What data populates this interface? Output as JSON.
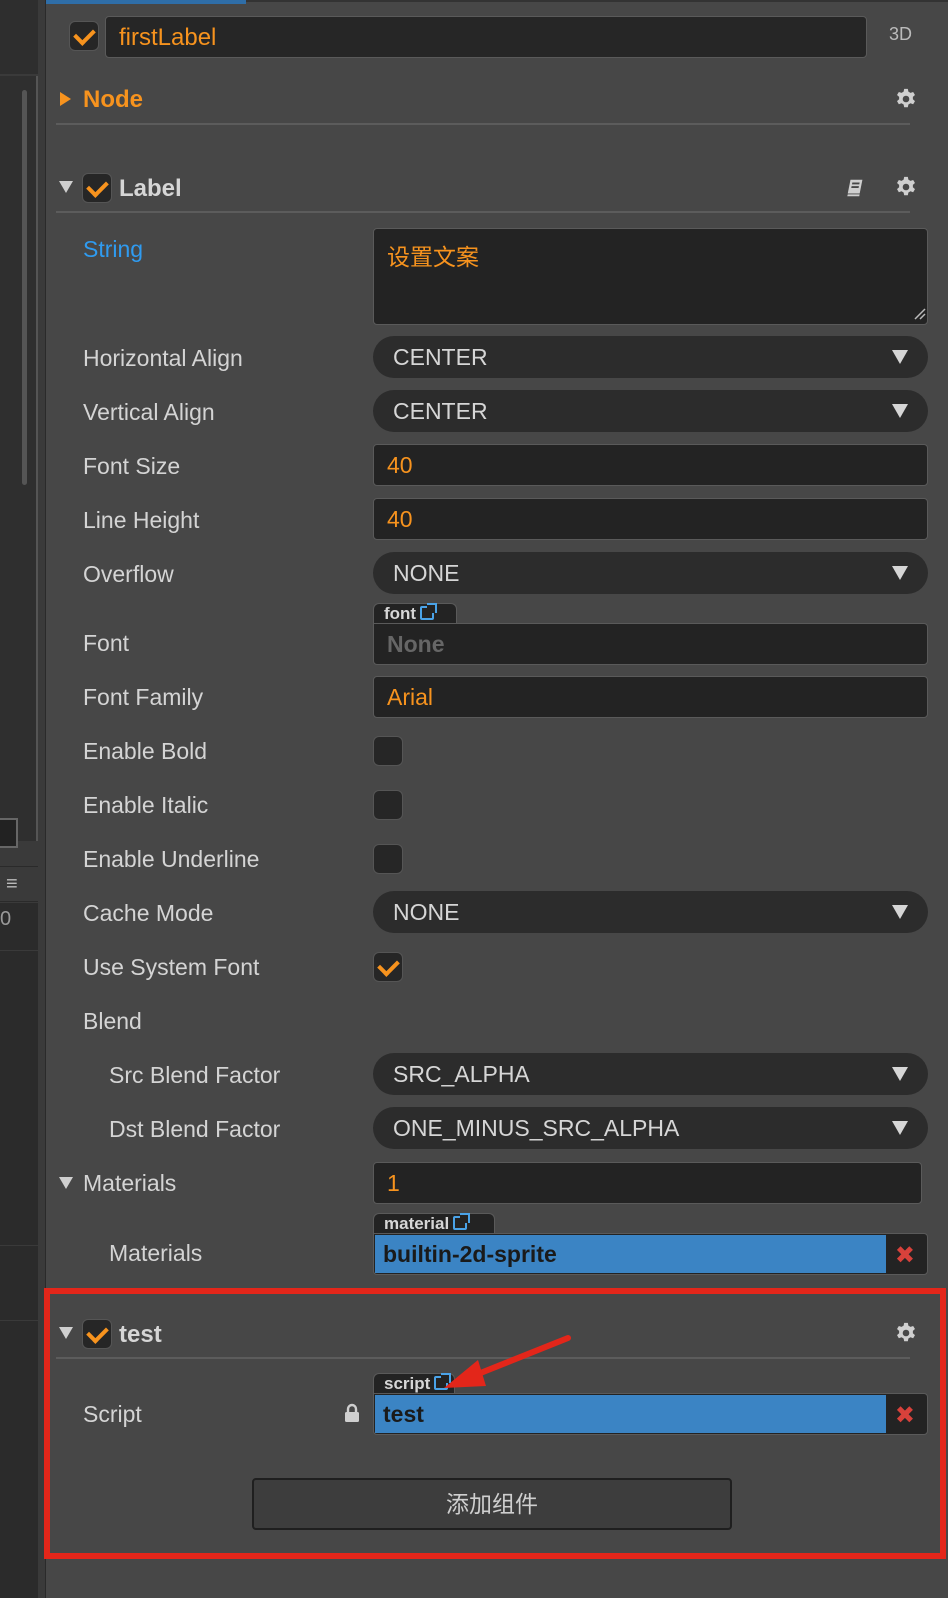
{
  "node_header": {
    "name": "firstLabel",
    "mode_badge": "3D"
  },
  "node_section": {
    "title": "Node"
  },
  "label_component": {
    "title": "Label",
    "props": {
      "string_label": "String",
      "string_value": "设置文案",
      "halign_label": "Horizontal Align",
      "halign_value": "CENTER",
      "valign_label": "Vertical Align",
      "valign_value": "CENTER",
      "font_size_label": "Font Size",
      "font_size_value": "40",
      "line_height_label": "Line Height",
      "line_height_value": "40",
      "overflow_label": "Overflow",
      "overflow_value": "NONE",
      "font_label": "Font",
      "font_tag": "font",
      "font_value": "None",
      "font_family_label": "Font Family",
      "font_family_value": "Arial",
      "bold_label": "Enable Bold",
      "italic_label": "Enable Italic",
      "underline_label": "Enable Underline",
      "cache_mode_label": "Cache Mode",
      "cache_mode_value": "NONE",
      "system_font_label": "Use System Font",
      "blend_label": "Blend",
      "src_blend_label": "Src Blend Factor",
      "src_blend_value": "SRC_ALPHA",
      "dst_blend_label": "Dst Blend Factor",
      "dst_blend_value": "ONE_MINUS_SRC_ALPHA",
      "materials_group_label": "Materials",
      "materials_count": "1",
      "materials_label": "Materials",
      "material_tag": "material",
      "material_value": "builtin-2d-sprite"
    }
  },
  "test_component": {
    "title": "test",
    "script_label": "Script",
    "script_tag": "script",
    "script_value": "test"
  },
  "add_component_label": "添加组件",
  "left_panel": {
    "readout": "0"
  },
  "colors": {
    "accent": "#f7931e",
    "link": "#2f9bf0",
    "asset_bg": "#3b84c4",
    "highlight": "#e3261a"
  }
}
